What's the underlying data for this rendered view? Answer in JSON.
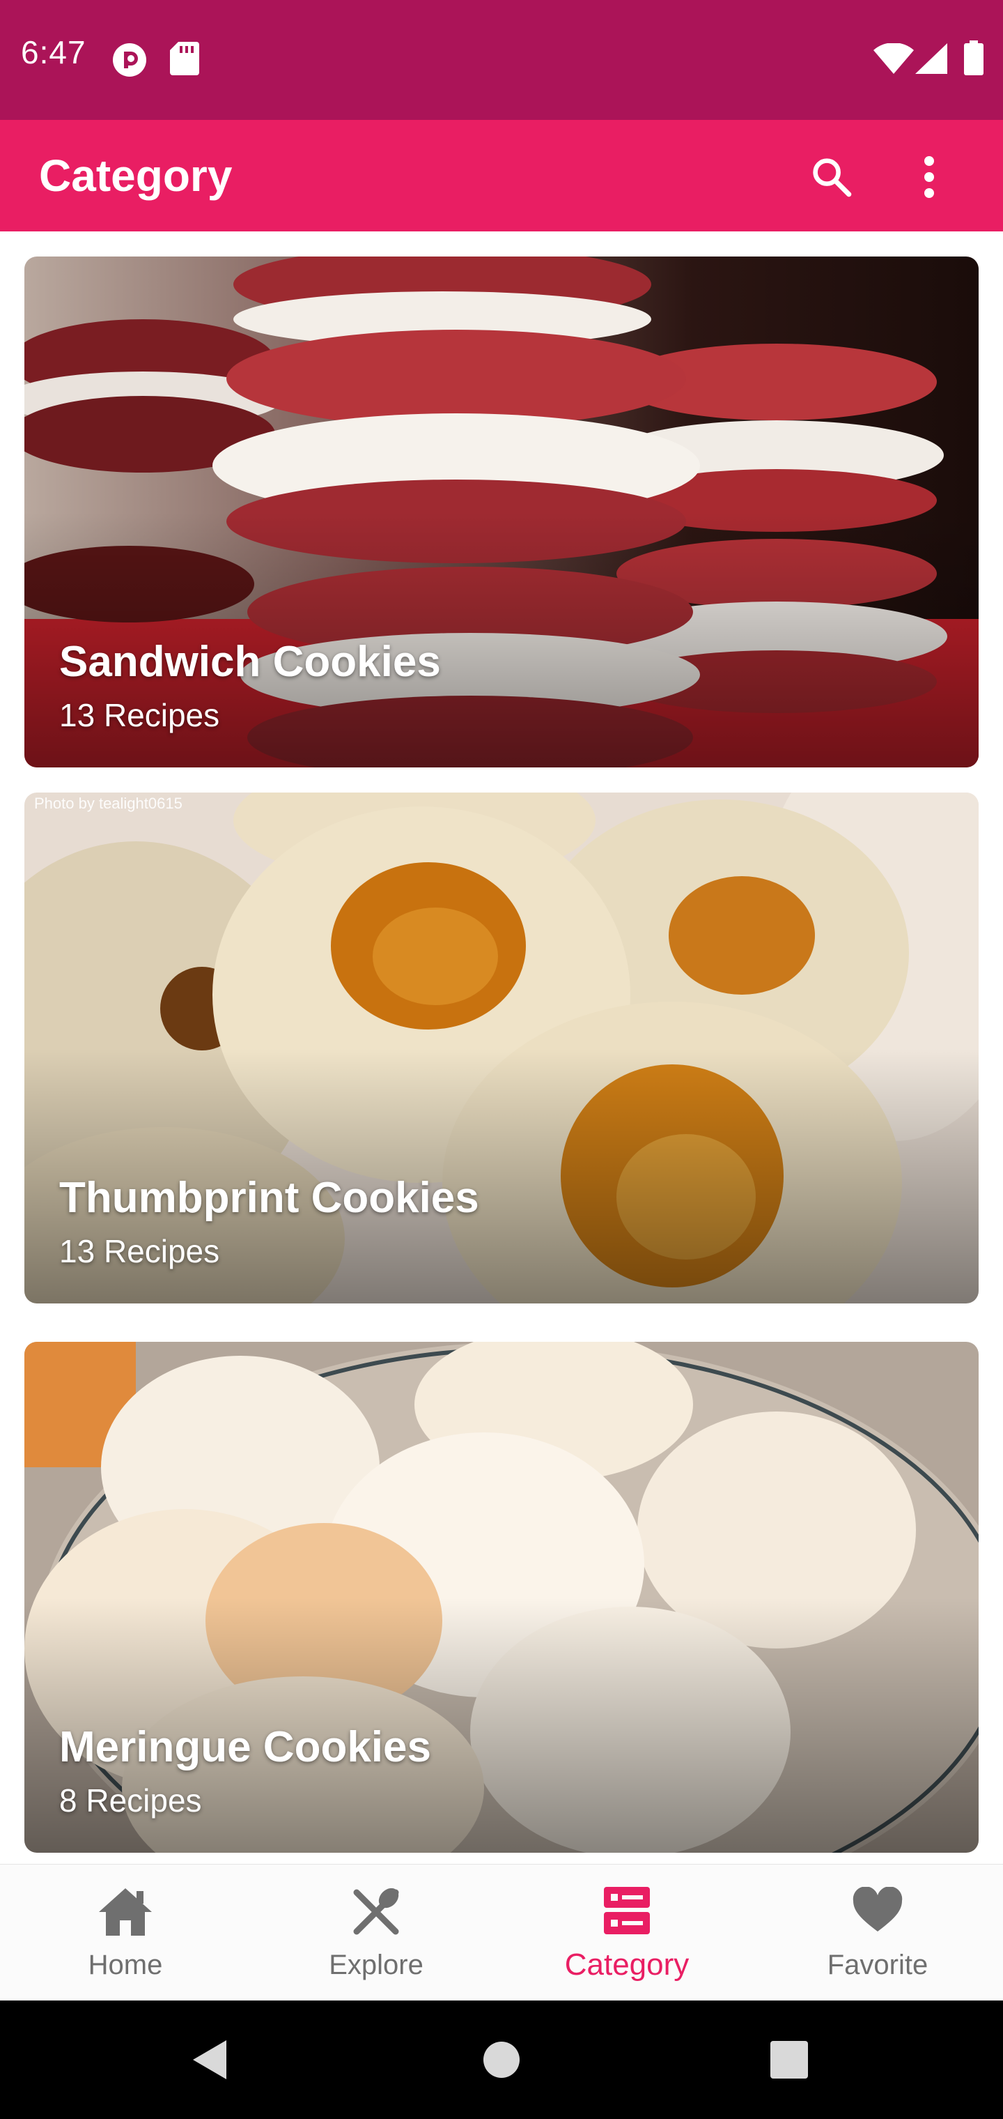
{
  "status_bar": {
    "time": "6:47",
    "background": "#ab1458",
    "left_icons": [
      "pocket-casts-icon",
      "sd-card-icon"
    ],
    "right_icons": [
      "wifi-icon",
      "cell-signal-icon",
      "battery-icon"
    ]
  },
  "app_bar": {
    "title": "Category",
    "background": "#e91e63",
    "actions": [
      "search-icon",
      "more-vert-icon"
    ]
  },
  "categories": [
    {
      "title": "Sandwich Cookies",
      "subtitle": "13 Recipes",
      "credit": ""
    },
    {
      "title": "Thumbprint Cookies",
      "subtitle": "13 Recipes",
      "credit": "Photo by tealight0615"
    },
    {
      "title": "Meringue Cookies",
      "subtitle": "8 Recipes",
      "credit": ""
    }
  ],
  "bottom_nav": {
    "items": [
      {
        "label": "Home",
        "icon": "home-icon",
        "active": false
      },
      {
        "label": "Explore",
        "icon": "utensils-icon",
        "active": false
      },
      {
        "label": "Category",
        "icon": "category-icon",
        "active": true
      },
      {
        "label": "Favorite",
        "icon": "heart-icon",
        "active": false
      }
    ],
    "active_color": "#e91e63",
    "inactive_color": "#6f6f6f"
  },
  "system_nav": [
    "back-icon",
    "home-circle-icon",
    "recents-icon"
  ]
}
